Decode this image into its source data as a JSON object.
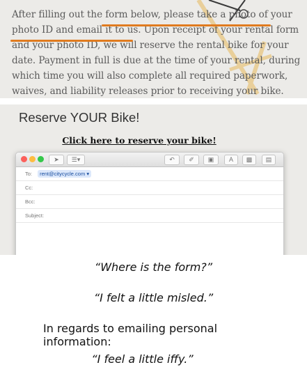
{
  "top_panel": {
    "paragraph": "After filling out the form below, please take a photo of your photo ID and email it to us. Upon receipt of your rental form and your photo ID, we will reserve the rental bike for your date. Payment in full is due at the time of your rental, during which time you will also complete all required paperwork, waives, and liability releases prior to receiving your bike.",
    "highlight_color": "#e07b1f"
  },
  "reserve": {
    "title": "Reserve YOUR Bike!",
    "link": "Click here to reserve your bike!"
  },
  "mail": {
    "toolbar_icons": [
      "send-icon",
      "format-list-icon",
      "undo-icon",
      "attach-icon",
      "photo-browser-icon",
      "font-icon",
      "image-icon",
      "notes-icon"
    ],
    "to_label": "To:",
    "to_value": "rent@citycycle.com",
    "cc_label": "Cc:",
    "bcc_label": "Bcc:",
    "subject_label": "Subject:",
    "colors": {
      "close": "#fc605c",
      "minimize": "#fdbc40",
      "zoom": "#34c84a"
    }
  },
  "quotes": {
    "q1": "“Where is the form?”",
    "q2": "“I felt a little misled.”",
    "regards_line1": "In regards to emailing personal",
    "regards_line2": "information:",
    "q3": "“I feel a little iffy.”"
  }
}
